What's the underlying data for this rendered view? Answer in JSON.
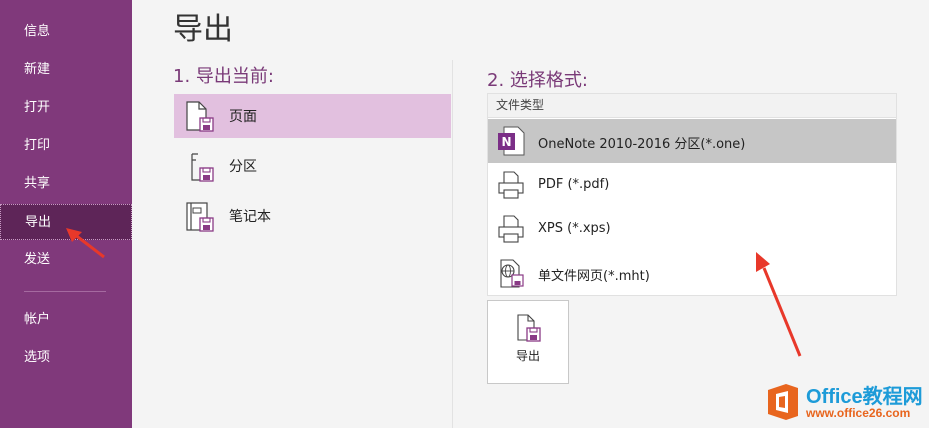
{
  "sidebar": {
    "items": [
      {
        "label": "信息"
      },
      {
        "label": "新建"
      },
      {
        "label": "打开"
      },
      {
        "label": "打印"
      },
      {
        "label": "共享"
      },
      {
        "label": "导出"
      },
      {
        "label": "发送"
      },
      {
        "label": "帐户"
      },
      {
        "label": "选项"
      }
    ],
    "active": "导出"
  },
  "main": {
    "title": "导出",
    "step1": {
      "heading": "1. 导出当前:",
      "items": [
        {
          "label": "页面",
          "icon": "page-icon",
          "selected": true
        },
        {
          "label": "分区",
          "icon": "section-icon",
          "selected": false
        },
        {
          "label": "笔记本",
          "icon": "notebook-icon",
          "selected": false
        }
      ]
    },
    "step2": {
      "heading": "2. 选择格式:",
      "list_header": "文件类型",
      "items": [
        {
          "label": "OneNote 2010-2016 分区(*.one)",
          "icon": "onenote-icon",
          "selected": true
        },
        {
          "label": "PDF (*.pdf)",
          "icon": "printer-icon",
          "selected": false
        },
        {
          "label": "XPS (*.xps)",
          "icon": "printer-icon",
          "selected": false
        },
        {
          "label": "单文件网页(*.mht)",
          "icon": "web-page-icon",
          "selected": false
        }
      ]
    },
    "export_button": {
      "label": "导出",
      "icon": "export-icon"
    }
  },
  "watermark": {
    "title": "Office教程网",
    "url": "www.office26.com"
  },
  "colors": {
    "sidebar_bg": "#80397b",
    "sidebar_active": "#5e2558",
    "accent": "#7a3a78",
    "selected_scope": "#e2c0df",
    "selected_format": "#c6c6c6",
    "annotation_arrow": "#e8382a"
  }
}
